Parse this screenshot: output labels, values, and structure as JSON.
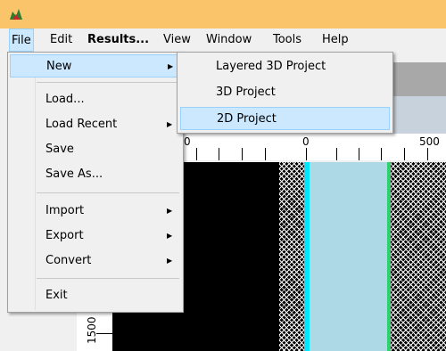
{
  "menubar": {
    "items": [
      {
        "label": "File"
      },
      {
        "label": "Edit"
      },
      {
        "label": "Results..."
      },
      {
        "label": "View"
      },
      {
        "label": "Window"
      },
      {
        "label": "Tools"
      },
      {
        "label": "Help"
      }
    ]
  },
  "file_menu": {
    "items": [
      {
        "label": "New",
        "has_submenu": true
      },
      {
        "label": "Load..."
      },
      {
        "label": "Load Recent",
        "has_submenu": true
      },
      {
        "label": "Save"
      },
      {
        "label": "Save As..."
      },
      {
        "label": "Import",
        "has_submenu": true
      },
      {
        "label": "Export",
        "has_submenu": true
      },
      {
        "label": "Convert",
        "has_submenu": true
      },
      {
        "label": "Exit"
      }
    ]
  },
  "new_submenu": {
    "items": [
      {
        "label": "Layered 3D Project"
      },
      {
        "label": "3D Project"
      },
      {
        "label": "2D Project"
      }
    ],
    "highlighted": "2D Project"
  },
  "ruler": {
    "top_labels": [
      "0",
      "0",
      "500"
    ],
    "left_label": "1500"
  },
  "colors": {
    "titlebar": "#f9c46a",
    "highlight": "#cce8ff",
    "cyan_band": "#00e6ff",
    "light_blue_band": "#add8e6",
    "green_band": "#30d070"
  },
  "icons": {
    "app": "app-logo-icon",
    "submenu_arrow": "triangle-right-icon"
  }
}
